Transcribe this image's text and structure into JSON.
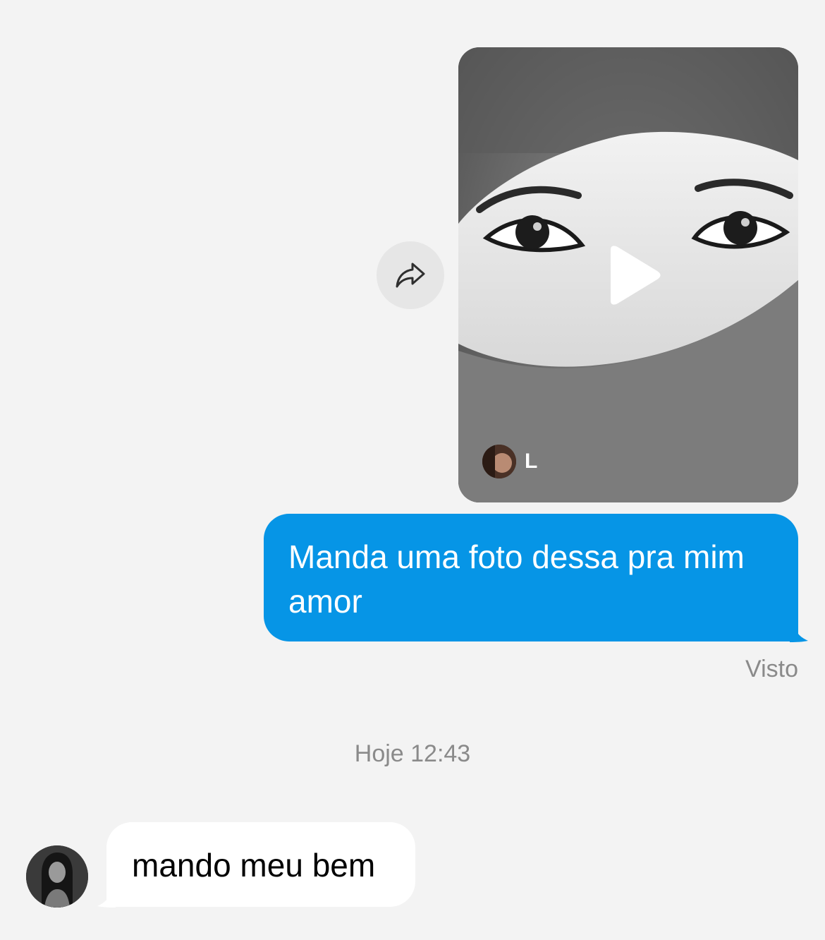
{
  "colors": {
    "background": "#f3f3f3",
    "sent_bubble": "#0695e6",
    "received_bubble": "#ffffff",
    "meta_text": "#8a8a8a"
  },
  "shared_video": {
    "author_initial": "L",
    "share_icon": "share-arrow-icon",
    "play_icon": "play-icon"
  },
  "messages": {
    "sent_text": "Manda uma foto dessa pra mim amor",
    "seen_status": "Visto",
    "timestamp": "Hoje 12:43",
    "received_text": "mando meu bem"
  }
}
